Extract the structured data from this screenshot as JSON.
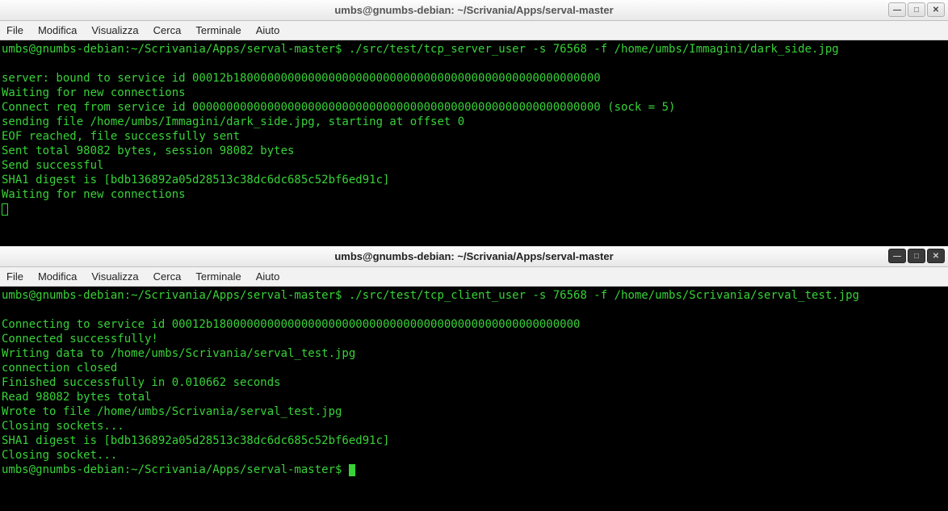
{
  "window1": {
    "title": "umbs@gnumbs-debian: ~/Scrivania/Apps/serval-master",
    "menu": [
      "File",
      "Modifica",
      "Visualizza",
      "Cerca",
      "Terminale",
      "Aiuto"
    ],
    "buttons": {
      "min": "—",
      "max": "□",
      "close": "✕"
    },
    "lines": [
      "umbs@gnumbs-debian:~/Scrivania/Apps/serval-master$ ./src/test/tcp_server_user -s 76568 -f /home/umbs/Immagini/dark_side.jpg",
      "",
      "server: bound to service id 00012b180000000000000000000000000000000000000000000000000000",
      "Waiting for new connections",
      "Connect req from service id 000000000000000000000000000000000000000000000000000000000000 (sock = 5)",
      "sending file /home/umbs/Immagini/dark_side.jpg, starting at offset 0",
      "EOF reached, file successfully sent",
      "Sent total 98082 bytes, session 98082 bytes",
      "Send successful",
      "SHA1 digest is [bdb136892a05d28513c38dc6dc685c52bf6ed91c]",
      "Waiting for new connections"
    ]
  },
  "window2": {
    "title": "umbs@gnumbs-debian: ~/Scrivania/Apps/serval-master",
    "menu": [
      "File",
      "Modifica",
      "Visualizza",
      "Cerca",
      "Terminale",
      "Aiuto"
    ],
    "buttons": {
      "min": "—",
      "max": "□",
      "close": "✕"
    },
    "lines": [
      "umbs@gnumbs-debian:~/Scrivania/Apps/serval-master$ ./src/test/tcp_client_user -s 76568 -f /home/umbs/Scrivania/serval_test.jpg",
      "",
      "Connecting to service id 00012b180000000000000000000000000000000000000000000000000000",
      "Connected successfully!",
      "Writing data to /home/umbs/Scrivania/serval_test.jpg",
      "connection closed",
      "Finished successfully in 0.010662 seconds",
      "Read 98082 bytes total",
      "Wrote to file /home/umbs/Scrivania/serval_test.jpg",
      "Closing sockets...",
      "SHA1 digest is [bdb136892a05d28513c38dc6dc685c52bf6ed91c]",
      "Closing socket...",
      "umbs@gnumbs-debian:~/Scrivania/Apps/serval-master$ "
    ]
  }
}
